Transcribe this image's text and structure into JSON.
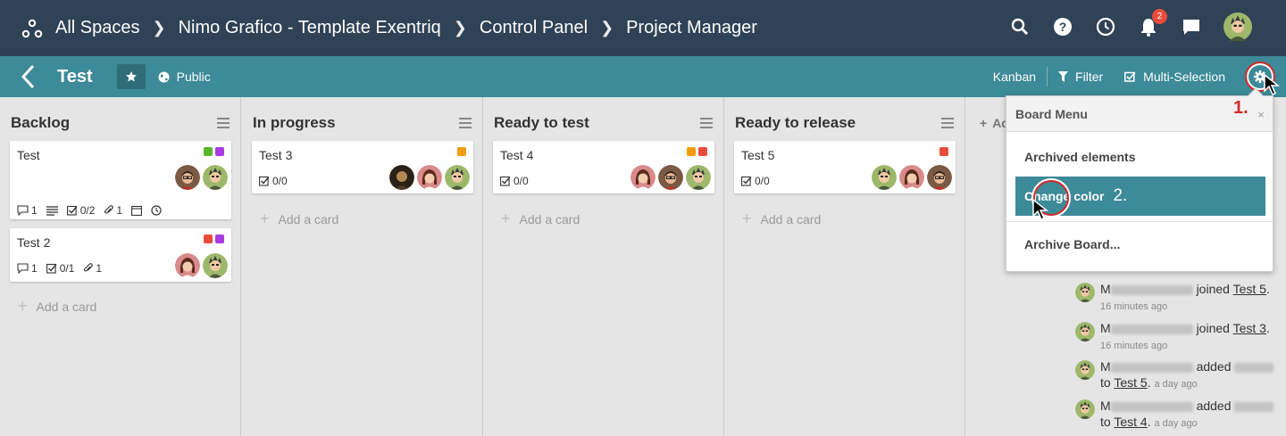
{
  "breadcrumb": {
    "items": [
      "All Spaces",
      "Nimo Grafico - Template Exentriq",
      "Control Panel",
      "Project Manager"
    ]
  },
  "topbar": {
    "notification_count": "2"
  },
  "board": {
    "title": "Test",
    "visibility": "Public"
  },
  "toolbar": {
    "view": "Kanban",
    "filter": "Filter",
    "multi": "Multi-Selection"
  },
  "add_list_label": "Ad",
  "add_card_label": "Add a card",
  "colors": {
    "topbar": "#2f4256",
    "subbar": "#3d8a98",
    "green": "#5ab52c",
    "purple": "#a83be0",
    "red": "#e84c3d",
    "orange": "#f39c12"
  },
  "lists": [
    {
      "name": "Backlog",
      "cards": [
        {
          "title": "Test",
          "labels": [
            "green",
            "purple"
          ],
          "comments": "1",
          "checklist": "0/2",
          "attachments": "1"
        },
        {
          "title": "Test 2",
          "labels": [
            "red",
            "purple"
          ],
          "comments": "1",
          "checklist": "0/1",
          "attachments": "1"
        }
      ]
    },
    {
      "name": "In progress",
      "cards": [
        {
          "title": "Test 3",
          "labels": [
            "orange"
          ],
          "checklist": "0/0"
        }
      ]
    },
    {
      "name": "Ready to test",
      "cards": [
        {
          "title": "Test 4",
          "labels": [
            "orange",
            "red"
          ],
          "checklist": "0/0"
        }
      ]
    },
    {
      "name": "Ready to release",
      "cards": [
        {
          "title": "Test 5",
          "labels": [
            "red"
          ],
          "checklist": "0/0"
        }
      ]
    }
  ],
  "board_menu": {
    "title": "Board Menu",
    "close": "×",
    "items": [
      "Archived elements",
      "Change color",
      "Archive Board..."
    ],
    "annotation_1": "1.",
    "annotation_2": "2."
  },
  "activity": [
    {
      "prefix": "M",
      "action": "joined",
      "target": "Test 5",
      "suffix": ".",
      "time": "16 minutes ago"
    },
    {
      "prefix": "M",
      "action": "joined",
      "target": "Test 3",
      "suffix": ".",
      "time": "16 minutes ago"
    },
    {
      "prefix": "M",
      "action": "added",
      "to": "to",
      "target": "Test 5",
      "suffix": ".",
      "time": "a day ago"
    },
    {
      "prefix": "M",
      "action": "added",
      "to": "to",
      "target": "Test 4",
      "suffix": ".",
      "time": "a day ago"
    }
  ]
}
